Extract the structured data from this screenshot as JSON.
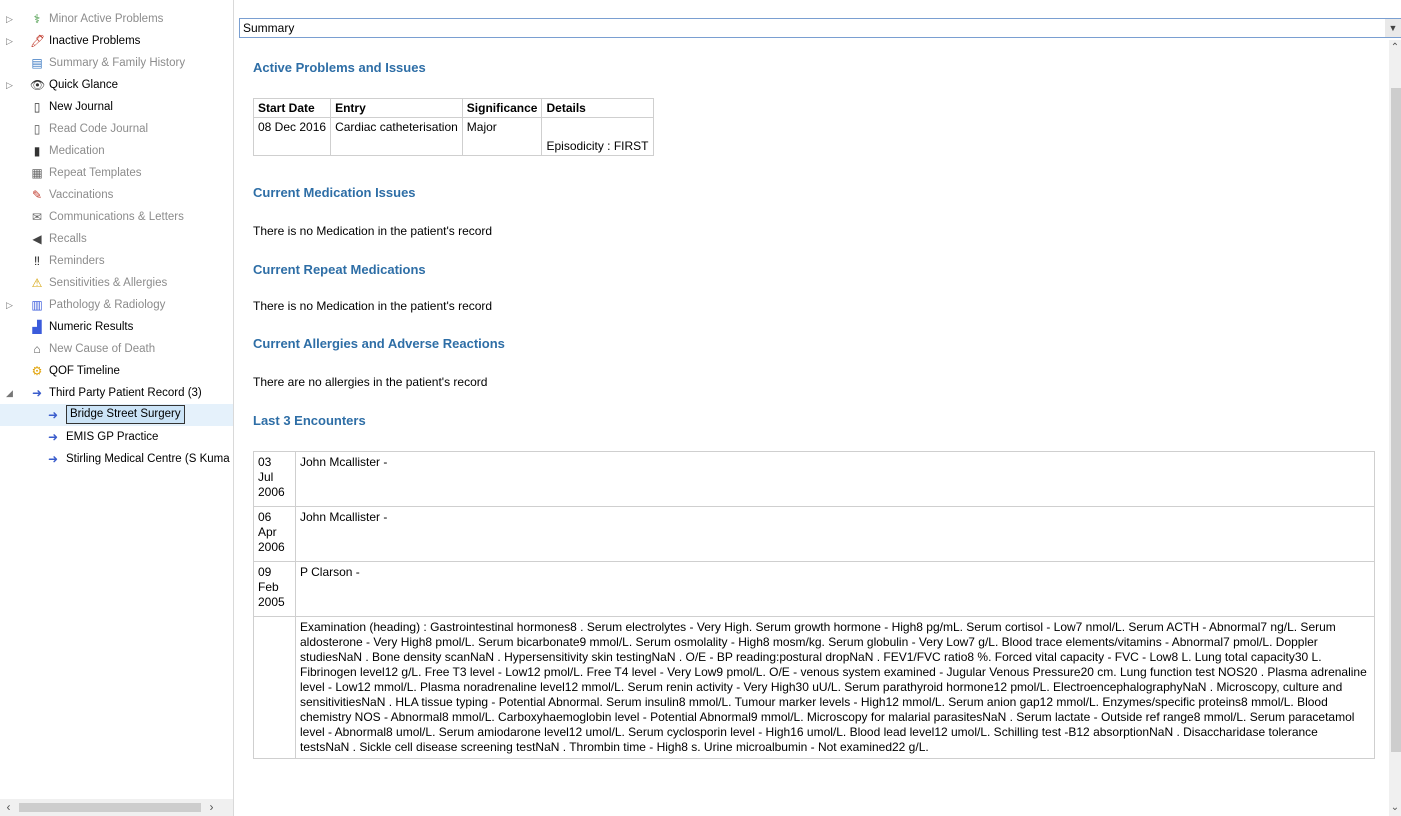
{
  "sidebar": {
    "items": [
      {
        "label": "Minor Active Problems",
        "icon": "minor-problems-icon",
        "glyph": "⚕",
        "color": "#2a8a2a",
        "expander": "▷",
        "dim": true
      },
      {
        "label": "Inactive Problems",
        "icon": "inactive-problems-icon",
        "glyph": "🖊",
        "color": "#c0392b",
        "expander": "▷",
        "dim": false
      },
      {
        "label": "Summary & Family History",
        "icon": "summary-icon",
        "glyph": "▤",
        "color": "#3a78c2",
        "expander": "",
        "dim": true
      },
      {
        "label": "Quick Glance",
        "icon": "quick-glance-icon",
        "glyph": "👁",
        "color": "#333",
        "expander": "▷",
        "dim": false
      },
      {
        "label": "New Journal",
        "icon": "journal-icon",
        "glyph": "▯",
        "color": "#333",
        "expander": "",
        "dim": false
      },
      {
        "label": "Read Code Journal",
        "icon": "read-code-journal-icon",
        "glyph": "▯",
        "color": "#555",
        "expander": "",
        "dim": true
      },
      {
        "label": "Medication",
        "icon": "medication-icon",
        "glyph": "▮",
        "color": "#333",
        "expander": "",
        "dim": true
      },
      {
        "label": "Repeat Templates",
        "icon": "repeat-templates-icon",
        "glyph": "▦",
        "color": "#666",
        "expander": "",
        "dim": true
      },
      {
        "label": "Vaccinations",
        "icon": "syringe-icon",
        "glyph": "✎",
        "color": "#c0392b",
        "expander": "",
        "dim": true
      },
      {
        "label": "Communications & Letters",
        "icon": "letters-icon",
        "glyph": "✉",
        "color": "#666",
        "expander": "",
        "dim": true
      },
      {
        "label": "Recalls",
        "icon": "recalls-icon",
        "glyph": "◀",
        "color": "#444",
        "expander": "",
        "dim": true
      },
      {
        "label": "Reminders",
        "icon": "reminders-icon",
        "glyph": "‼",
        "color": "#222",
        "expander": "",
        "dim": true
      },
      {
        "label": "Sensitivities & Allergies",
        "icon": "allergies-icon",
        "glyph": "⚠",
        "color": "#d4a000",
        "expander": "",
        "dim": true
      },
      {
        "label": "Pathology & Radiology",
        "icon": "pathology-icon",
        "glyph": "▥",
        "color": "#3b5bdb",
        "expander": "▷",
        "dim": true
      },
      {
        "label": "Numeric Results",
        "icon": "numeric-results-icon",
        "glyph": "▟",
        "color": "#3b5bdb",
        "expander": "",
        "dim": false
      },
      {
        "label": "New Cause of Death",
        "icon": "cause-of-death-icon",
        "glyph": "⌂",
        "color": "#555",
        "expander": "",
        "dim": true
      },
      {
        "label": "QOF Timeline",
        "icon": "qof-timeline-icon",
        "glyph": "⚙",
        "color": "#e0a000",
        "expander": "",
        "dim": false
      },
      {
        "label": "Third Party Patient Record (3)",
        "icon": "third-party-record-icon",
        "glyph": "➜",
        "color": "#3a5ccc",
        "expander": "◢",
        "dim": false
      },
      {
        "label": "Bridge Street Surgery",
        "icon": "bridge-street-record-icon",
        "glyph": "➜",
        "color": "#3a5ccc",
        "expander": "",
        "dim": false,
        "child": true,
        "selected": true
      },
      {
        "label": "EMIS GP Practice",
        "icon": "emis-practice-record-icon",
        "glyph": "➜",
        "color": "#3a5ccc",
        "expander": "",
        "dim": false,
        "child": true
      },
      {
        "label": "Stirling Medical Centre (S Kuma",
        "icon": "stirling-record-icon",
        "glyph": "➜",
        "color": "#3a5ccc",
        "expander": "",
        "dim": false,
        "child": true
      }
    ]
  },
  "view_select": {
    "value": "Summary"
  },
  "sections": {
    "active_problems": {
      "heading": "Active Problems and Issues",
      "columns": [
        "Start Date",
        "Entry",
        "Significance",
        "Details"
      ],
      "rows": [
        {
          "start_date": "08 Dec 2016",
          "entry": "Cardiac catheterisation",
          "significance": "Major",
          "details": "Episodicity : FIRST"
        }
      ]
    },
    "current_medication": {
      "heading": "Current Medication Issues",
      "text": "There is no Medication in the patient's record"
    },
    "repeat_medication": {
      "heading": "Current Repeat Medications",
      "text": "There is no Medication in the patient's record"
    },
    "allergies": {
      "heading": "Current Allergies and Adverse Reactions",
      "text": "There are no allergies in the patient's record"
    },
    "encounters": {
      "heading": "Last 3 Encounters",
      "rows": [
        {
          "day": "03",
          "month": "Jul",
          "year": "2006",
          "clinician": "John Mcallister -"
        },
        {
          "day": "06",
          "month": "Apr",
          "year": "2006",
          "clinician": "John Mcallister -"
        },
        {
          "day": "09",
          "month": "Feb",
          "year": "2005",
          "clinician": "P Clarson -"
        }
      ],
      "examination": "Examination (heading) : Gastrointestinal hormones8 . Serum electrolytes - Very High. Serum growth hormone - High8 pg/mL. Serum cortisol - Low7 nmol/L. Serum ACTH - Abnormal7 ng/L. Serum aldosterone - Very High8 pmol/L. Serum bicarbonate9 mmol/L. Serum osmolality - High8 mosm/kg. Serum globulin - Very Low7 g/L. Blood trace elements/vitamins - Abnormal7 pmol/L. Doppler studiesNaN . Bone density scanNaN . Hypersensitivity skin testingNaN . O/E - BP reading:postural dropNaN . FEV1/FVC ratio8 %. Forced vital capacity - FVC - Low8 L. Lung total capacity30 L. Fibrinogen level12 g/L. Free T3 level - Low12 pmol/L. Free T4 level - Very Low9 pmol/L. O/E - venous system examined - Jugular Venous Pressure20 cm. Lung function test NOS20 . Plasma adrenaline level - Low12 mmol/L. Plasma noradrenaline level12 mmol/L. Serum renin activity - Very High30 uU/L. Serum parathyroid hormone12 pmol/L. ElectroencephalographyNaN . Microscopy, culture and sensitivitiesNaN . HLA tissue typing - Potential Abnormal. Serum insulin8 mmol/L. Tumour marker levels - High12 mmol/L. Serum anion gap12 mmol/L. Enzymes/specific proteins8 mmol/L. Blood chemistry NOS - Abnormal8 mmol/L. Carboxyhaemoglobin level - Potential Abnormal9 mmol/L. Microscopy for malarial parasitesNaN . Serum lactate - Outside ref range8 mmol/L. Serum paracetamol level - Abnormal8 umol/L. Serum amiodarone level12 umol/L. Serum cyclosporin level - High16 umol/L. Blood lead level12 umol/L. Schilling test -B12 absorptionNaN . Disaccharidase tolerance testsNaN . Sickle cell disease screening testNaN . Thrombin time - High8 s. Urine microalbumin - Not examined22 g/L."
    }
  }
}
